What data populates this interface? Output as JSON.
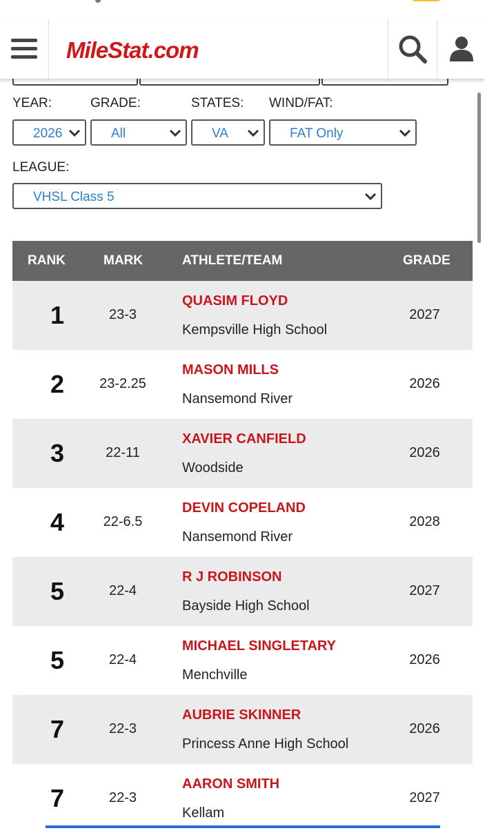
{
  "header": {
    "logo": "MileStat.com",
    "icons": [
      "hamburger-menu-icon",
      "search-icon",
      "user-icon"
    ]
  },
  "filters": {
    "year_label": "YEAR:",
    "year_value": "2026",
    "grade_label": "GRADE:",
    "grade_value": "All",
    "states_label": "STATES:",
    "states_value": "VA",
    "wind_label": "WIND/FAT:",
    "wind_value": "FAT Only",
    "league_label": "LEAGUE:",
    "league_value": "VHSL Class 5"
  },
  "table": {
    "headers": {
      "rank": "RANK",
      "mark": "MARK",
      "athlete": "ATHLETE/TEAM",
      "grade": "GRADE"
    },
    "rows": [
      {
        "rank": "1",
        "mark": "23-3",
        "athlete": "QUASIM FLOYD",
        "team": "Kempsville High School",
        "grade": "2027"
      },
      {
        "rank": "2",
        "mark": "23-2.25",
        "athlete": "MASON MILLS",
        "team": "Nansemond River",
        "grade": "2026"
      },
      {
        "rank": "3",
        "mark": "22-11",
        "athlete": "XAVIER CANFIELD",
        "team": "Woodside",
        "grade": "2026"
      },
      {
        "rank": "4",
        "mark": "22-6.5",
        "athlete": "DEVIN COPELAND",
        "team": "Nansemond River",
        "grade": "2028"
      },
      {
        "rank": "5",
        "mark": "22-4",
        "athlete": "R J ROBINSON",
        "team": "Bayside High School",
        "grade": "2027"
      },
      {
        "rank": "5",
        "mark": "22-4",
        "athlete": "MICHAEL SINGLETARY",
        "team": "Menchville",
        "grade": "2026"
      },
      {
        "rank": "7",
        "mark": "22-3",
        "athlete": "AUBRIE SKINNER",
        "team": "Princess Anne High School",
        "grade": "2026"
      },
      {
        "rank": "7",
        "mark": "22-3",
        "athlete": "AARON SMITH",
        "team": "Kellam",
        "grade": "2027"
      }
    ]
  },
  "colors": {
    "brand_red": "#d0161b",
    "athlete_red": "#c8161d",
    "select_value_blue": "#2a7fd4",
    "table_header_bg": "#666666",
    "alt_row_bg": "#ebebeb"
  }
}
